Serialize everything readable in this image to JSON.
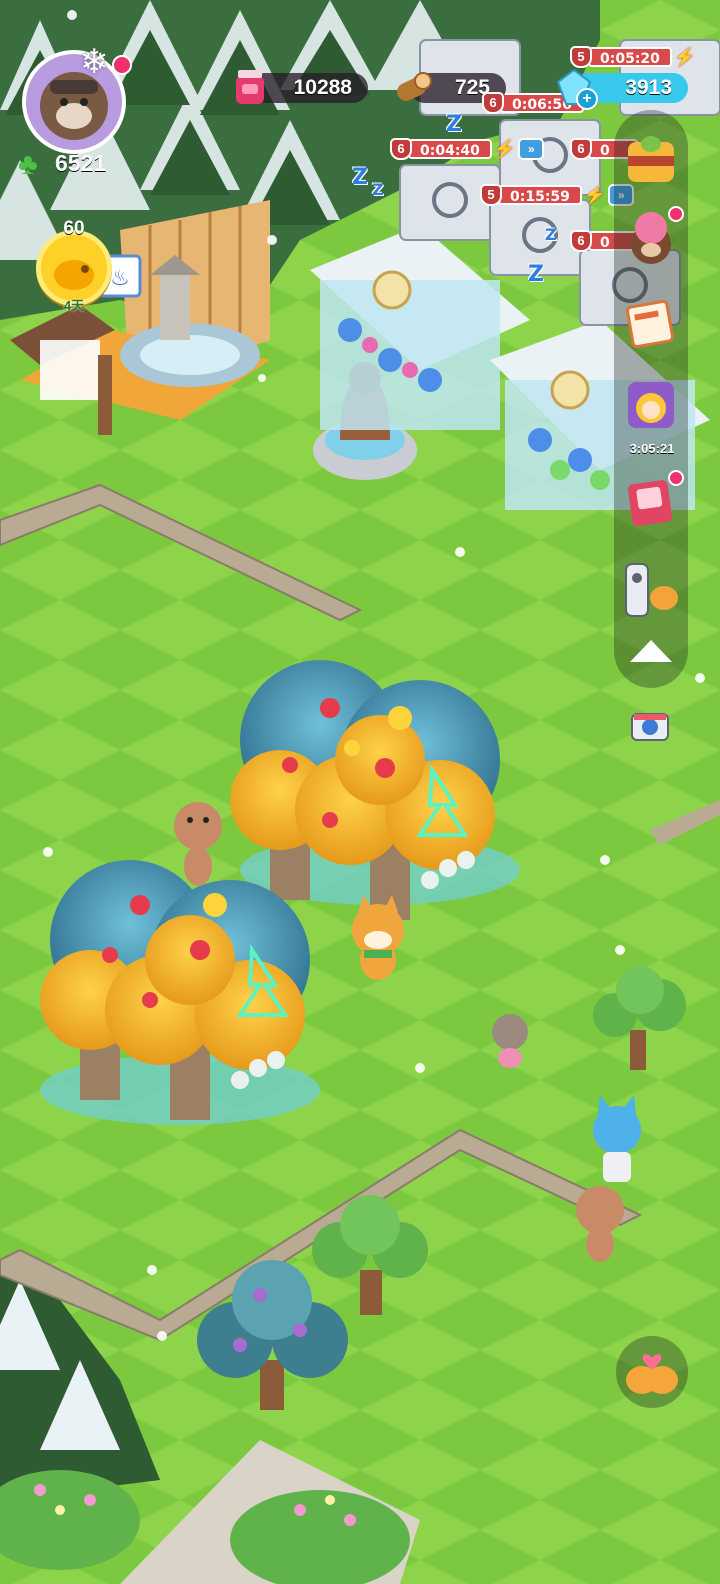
{
  "player": {
    "avatar_badge_icon": "snowflake-icon",
    "clover_count": "6521"
  },
  "event": {
    "level": "60",
    "days_left": "4天"
  },
  "resources": {
    "jam": {
      "icon": "jam-jar-icon",
      "value": "10288"
    },
    "wood": {
      "icon": "log-icon",
      "value": "725"
    },
    "gems": {
      "icon": "gem-icon",
      "value": "3913",
      "add_label": "+"
    }
  },
  "timers": [
    {
      "level": "5",
      "time": "0:05:20"
    },
    {
      "level": "6",
      "time": "0:06:56"
    },
    {
      "level": "6",
      "time": "0:04:40"
    },
    {
      "level": "6",
      "time": "0"
    },
    {
      "level": "5",
      "time": "0:15:59"
    },
    {
      "level": "6",
      "time": "0"
    }
  ],
  "sidebar": {
    "event_timer": "3:05:21",
    "collapse_icon": "triangle-up-icon"
  },
  "colors": {
    "grass_light": "#8fd24a",
    "grass_dark": "#6fbf3a",
    "timer_red": "#d94949",
    "gem_cyan": "#38c8ec",
    "notification_pink": "#f0306e"
  }
}
